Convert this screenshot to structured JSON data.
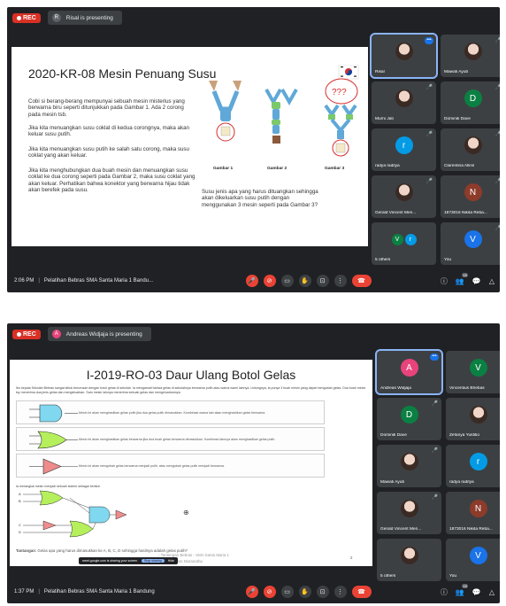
{
  "m1": {
    "rec": "REC",
    "presenter_initial": "R",
    "presenter_text": "Risal is presenting",
    "slide": {
      "title": "2020-KR-08 Mesin Penuang Susu",
      "p1": "Cobi si berang-berang mempunyai sebuah mesin misterius yang berwarna biru seperti ditunjukkan pada Gambar 1. Ada 2 corong pada mesin tsb.",
      "p2": "Jika kita menuangkan susu coklat di kedua corongnya, maka akan keluar susu putih.",
      "p3": "Jika kita menuangkan susu putih ke salah satu corong, maka susu coklat yang akan keluar.",
      "p4": "Jika kita menghubungkan dua buah mesin dan menuangkan susu coklat ke dua corong seperti pada Gambar 2, maka susu coklat yang akan keluar. Perhatikan bahwa konektor yang berwarna hijau tidak akan berefek pada susu.",
      "cap1": "Gambar 1",
      "cap2": "Gambar 2",
      "cap3": "Gambar 3",
      "question": "Susu jenis apa yang harus dituangkan sehingga akan dikeluarkan susu putih dengan menggunakan 3 mesin seperti pada Gambar 3?",
      "qmarks": "???"
    },
    "tiles": [
      {
        "name": "Risal",
        "type": "photo",
        "active": true,
        "more": "•••"
      },
      {
        "name": "Mawati Ayub",
        "type": "photo",
        "mic": "🎤"
      },
      {
        "name": "Murni Jati",
        "type": "photo",
        "mic": "🎤"
      },
      {
        "name": "Dominik Dave",
        "initial": "D",
        "color": "#0b8043",
        "mic": "🎤"
      },
      {
        "name": "radya raditya",
        "initial": "r",
        "color": "#039be5",
        "mic": "🎤"
      },
      {
        "name": "Clarentina Allins",
        "type": "photo",
        "mic": "🎤"
      },
      {
        "name": "Gerald Vincent Men...",
        "type": "photo",
        "mic": "🎤"
      },
      {
        "name": "1873016 Nikita Reba...",
        "initial": "N",
        "color": "#8d3b2a",
        "mic": "🎤"
      },
      {
        "name": "5 others",
        "initial": "V",
        "initial2": "r",
        "color": "#0b8043",
        "color2": "#039be5"
      },
      {
        "name": "You",
        "initial": "V",
        "color": "#1a73e8",
        "mic": "🎤"
      }
    ],
    "bottom": {
      "time": "2:06 PM",
      "title": "Pelatihan Bebras SMA Santa Maria 1 Bandu..."
    }
  },
  "m2": {
    "rec": "REC",
    "presenter_initial": "A",
    "presenter_text": "Andreas Widjaja is presenting",
    "slide": {
      "title": "I-2019-RO-03 Daur Ulang Botol Gelas",
      "intro": "Ibu kepala Sekolah Bebras sangat sibuk berurusan dengan botol gelas di sekolah. Ia mengamati bahwa gelas di sekolahnya berwarna putih atau warna warni lainnya. Untungnya, ia punya 3 buah mesin yang dapat mengubah gelas. Dua buah mesin tsy menerima dua jenis gelas dan mengeluarkan. Satu mesin lainnya menerima sebuah gelas dan mengeluarkannya.",
      "g1": "Mesin ini akan menghasilkan gelas putih jika dua gelas putih dimasukkan. Kombinasi warna lain akan menghasilkan gelas berwarna.",
      "g2": "Mesin ini akan menghasilkan gelas berwarna jika dua buah gelas berwarna dimasukkan. Kombinasi lainnya akan menghasilkan gelas putih.",
      "g3": "Mesin ini akan mengubah gelas berwarna menjadi putih, atau mengubah gelas putih menjadi berwarna.",
      "circuit_intro": "Ia merangkai mesin menjadi sebuah sistem sebagai berikut:",
      "labels": [
        "A",
        "B",
        "C",
        "D"
      ],
      "question_label": "Tantangan",
      "question": ": Gelas apa yang harus dimasukkan ke A, B, C, D sehingga hasilnya adalah gelas putih?",
      "footer1": "- Tantangan Bebras - SMA Santa Maria 1",
      "footer2": "- Biro Bebras Maranatha",
      "page": "2",
      "tooltip": "meet.google.com is sharing your screen.",
      "tooltip_btn": "Stop sharing",
      "tooltip_hide": "Hide"
    },
    "tiles": [
      {
        "name": "Andreas Widjaja",
        "initial": "A",
        "color": "#e8437b",
        "active": true,
        "more": "•••"
      },
      {
        "name": "Vincentius Bhebas",
        "initial": "V",
        "color": "#0b8043",
        "mic": "🎤"
      },
      {
        "name": "Dominik Dave",
        "initial": "D",
        "color": "#0b8043",
        "mic": "🎤"
      },
      {
        "name": "Zefanya Yustitio",
        "type": "photo",
        "mic": "🎤"
      },
      {
        "name": "Mawati Ayub",
        "type": "photo",
        "mic": "🎤"
      },
      {
        "name": "radya raditya",
        "initial": "r",
        "color": "#039be5",
        "mic": "🎤"
      },
      {
        "name": "Gerald Vincent Men...",
        "type": "photo",
        "mic": "🎤"
      },
      {
        "name": "1873016 Nikita Reba...",
        "initial": "N",
        "color": "#8d3b2a",
        "mic": "🎤"
      },
      {
        "name": "5 others",
        "type": "photo"
      },
      {
        "name": "You",
        "initial": "V",
        "color": "#1a73e8",
        "mic": "🎤"
      }
    ],
    "bottom": {
      "time": "1:37 PM",
      "title": "Pelatihan Bebras SMA Santa Maria 1 Bandung"
    }
  },
  "controls": {
    "mic": "🎤",
    "cam": "⊘",
    "cc": "▭",
    "hand": "✋",
    "present": "⊡",
    "more": "⋮",
    "end": "☎",
    "info": "ⓘ",
    "people": "👥",
    "chat": "💬",
    "activities": "△",
    "count1": "15",
    "count2": "15"
  },
  "colors": {
    "meet_bg": "#202124",
    "tile_bg": "#3c4043",
    "rec": "#d93025",
    "end": "#ea4335",
    "gate_blue": "#7fd8f0",
    "gate_green": "#b5ef5b",
    "gate_red": "#ee8b8b"
  }
}
